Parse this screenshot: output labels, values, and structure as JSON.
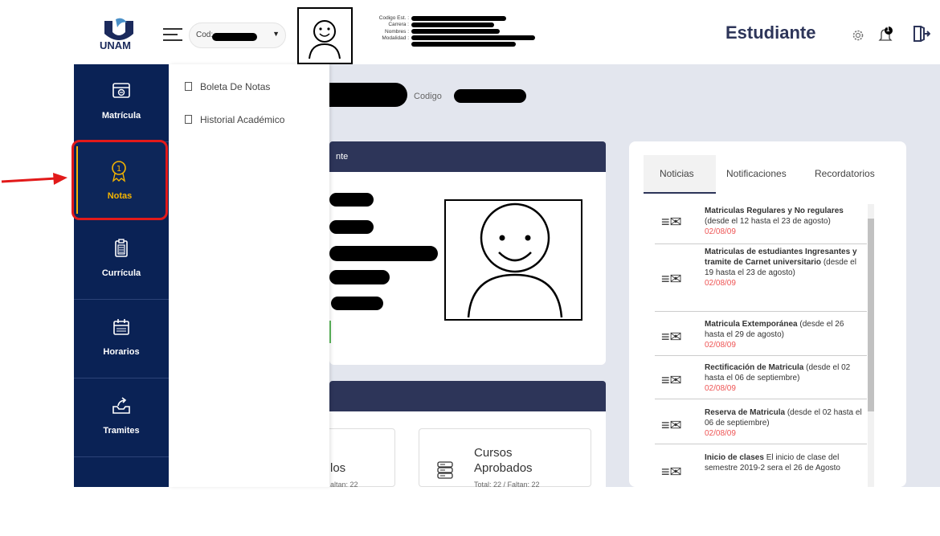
{
  "header": {
    "logo_text": "UNAM",
    "cod_label": "Cod:",
    "info_labels": [
      "Codigo Est. :",
      "Carrera :",
      "Nombres :",
      "Modalidad :"
    ],
    "role": "Estudiante",
    "notification_count": "1"
  },
  "sidebar": {
    "items": [
      {
        "label": "Matrícula",
        "icon": "card-icon"
      },
      {
        "label": "Notas",
        "icon": "medal-icon"
      },
      {
        "label": "Currícula",
        "icon": "clipboard-icon"
      },
      {
        "label": "Horarios",
        "icon": "calendar-icon"
      },
      {
        "label": "Tramites",
        "icon": "inbox-upload-icon"
      }
    ]
  },
  "notas_menu": {
    "items": [
      "Boleta De Notas",
      "Historial Académico"
    ]
  },
  "profile": {
    "code_label": "Codigo",
    "card_title_partial": "nte"
  },
  "stats": {
    "left_partial_title": "los",
    "left_partial_sub": "altan: 22",
    "right_title_line1": "Cursos",
    "right_title_line2": "Aprobados",
    "right_sub": "Total: 22 / Faltan: 22"
  },
  "news_panel": {
    "tabs": [
      "Noticias",
      "Notificaciones",
      "Recordatorios"
    ],
    "items": [
      {
        "title": "Matriculas Regulares y No regulares",
        "detail": " (desde el 12 hasta el 23 de agosto)",
        "date": "02/08/09"
      },
      {
        "title": "Matriculas de estudiantes Ingresantes y tramite de Carnet universitario",
        "detail": "  (desde el 19 hasta el 23 de agosto)",
        "date": "02/08/09"
      },
      {
        "title": "Matricula Extemporánea",
        "detail": "  (desde el 26 hasta el 29 de agosto)",
        "date": "02/08/09"
      },
      {
        "title": "Rectificación de Matricula",
        "detail": "  (desde el 02 hasta el 06 de septiembre)",
        "date": "02/08/09"
      },
      {
        "title": "Reserva de Matricula",
        "detail": "  (desde el 02 hasta el 06 de septiembre)",
        "date": "02/08/09"
      },
      {
        "title": "Inicio de clases",
        "detail": "  El inicio de clase del semestre 2019-2 sera el 26 de Agosto",
        "date": ""
      }
    ]
  },
  "colors": {
    "sidebar": "#0a2255",
    "accent": "#2d3559",
    "highlight": "#e21a1a",
    "date": "#e55555"
  }
}
